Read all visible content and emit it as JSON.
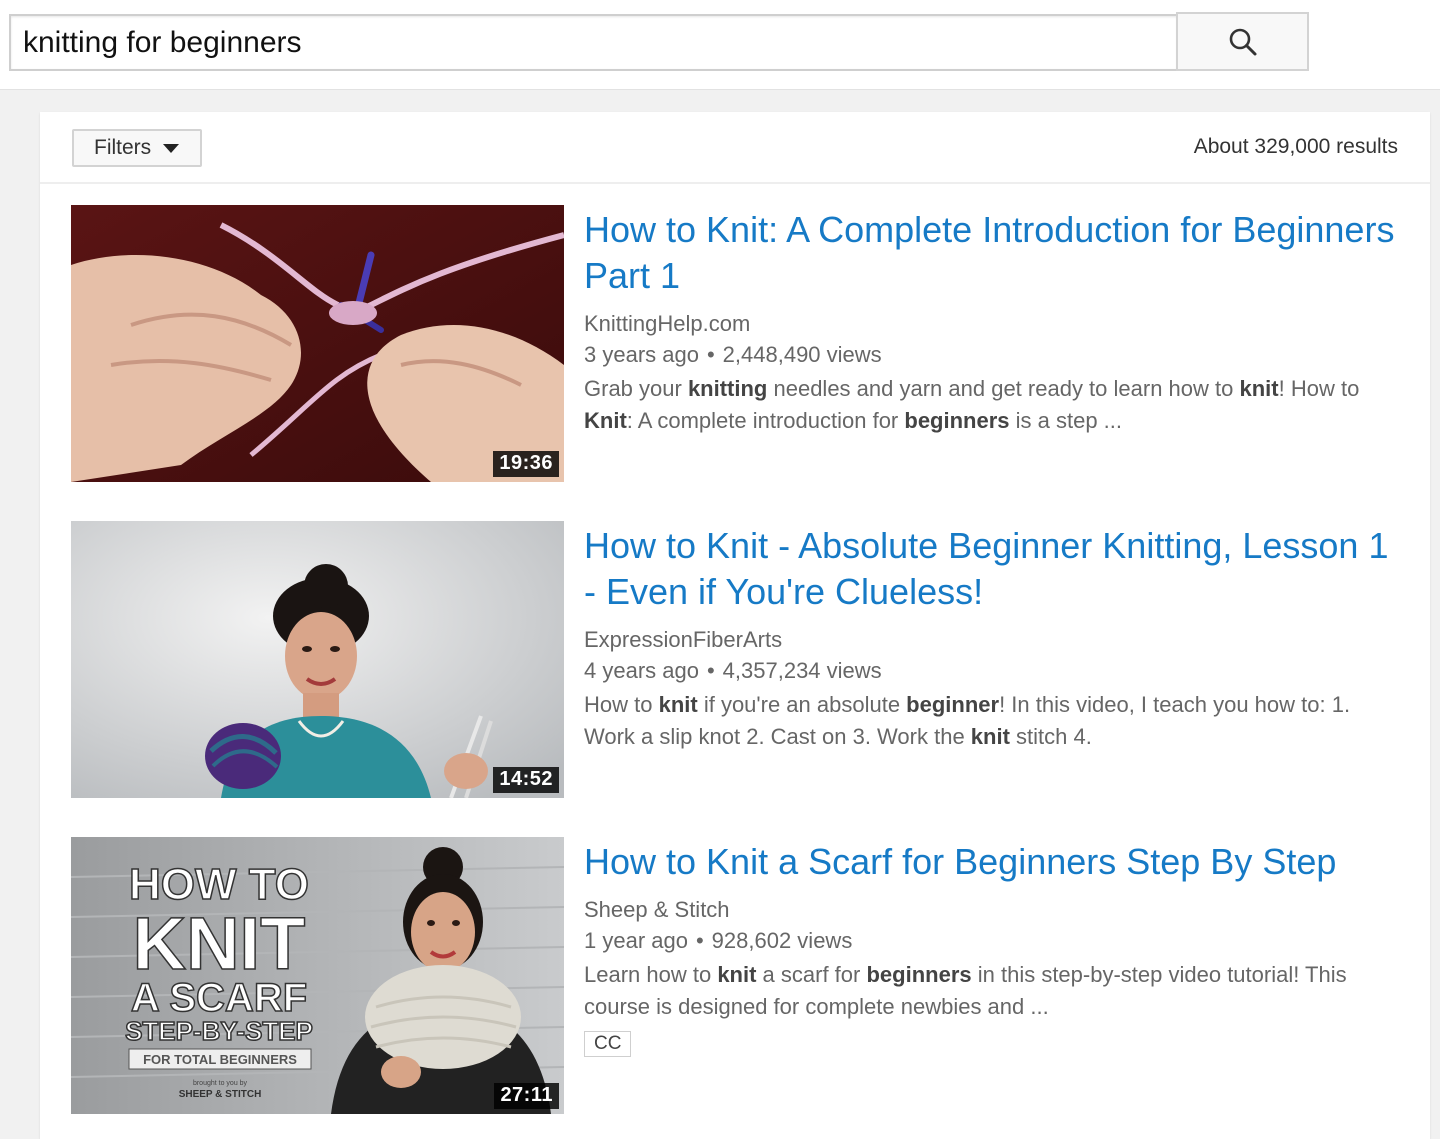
{
  "search": {
    "query": "knitting for beginners"
  },
  "filters": {
    "label": "Filters"
  },
  "results_count": "About 329,000 results",
  "results": [
    {
      "title": "How to Knit: A Complete Introduction for Beginners Part 1",
      "channel": "KnittingHelp.com",
      "age": "3 years ago",
      "views": "2,448,490 views",
      "description": [
        {
          "t": "Grab your "
        },
        {
          "t": "knitting",
          "b": true
        },
        {
          "t": " needles and yarn and get ready to learn how to "
        },
        {
          "t": "knit",
          "b": true
        },
        {
          "t": "! How to "
        },
        {
          "t": "Knit",
          "b": true
        },
        {
          "t": ": A complete introduction for "
        },
        {
          "t": "beginners",
          "b": true
        },
        {
          "t": " is a step ..."
        }
      ],
      "duration": "19:36",
      "badge": ""
    },
    {
      "title": "How to Knit - Absolute Beginner Knitting, Lesson 1 - Even if You're Clueless!",
      "channel": "ExpressionFiberArts",
      "age": "4 years ago",
      "views": "4,357,234 views",
      "description": [
        {
          "t": "How to "
        },
        {
          "t": "knit",
          "b": true
        },
        {
          "t": " if you're an absolute "
        },
        {
          "t": "beginner",
          "b": true
        },
        {
          "t": "! In this video, I teach you how to: 1. Work a slip knot 2. Cast on 3. Work the "
        },
        {
          "t": "knit",
          "b": true
        },
        {
          "t": " stitch 4."
        }
      ],
      "duration": "14:52",
      "badge": ""
    },
    {
      "title": "How to Knit a Scarf for Beginners Step By Step",
      "channel": "Sheep & Stitch",
      "age": "1 year ago",
      "views": "928,602 views",
      "description": [
        {
          "t": "Learn how to "
        },
        {
          "t": "knit",
          "b": true
        },
        {
          "t": " a scarf for "
        },
        {
          "t": "beginners",
          "b": true
        },
        {
          "t": " in this step-by-step video tutorial! This course is designed for complete newbies and ..."
        }
      ],
      "duration": "27:11",
      "badge": "CC",
      "thumb_text": {
        "line1": "HOW TO",
        "line2": "KNIT",
        "line3": "A SCARF",
        "line4": "STEP-BY-STEP",
        "line5": "FOR TOTAL BEGINNERS",
        "line6": "brought to you by",
        "line7": "SHEEP & STITCH"
      }
    }
  ],
  "colors": {
    "title_link": "#167ac6",
    "meta_text": "#666666",
    "page_bg": "#f1f1f1"
  },
  "icons": {
    "search": "search-icon",
    "filters": "caret-down-icon"
  }
}
